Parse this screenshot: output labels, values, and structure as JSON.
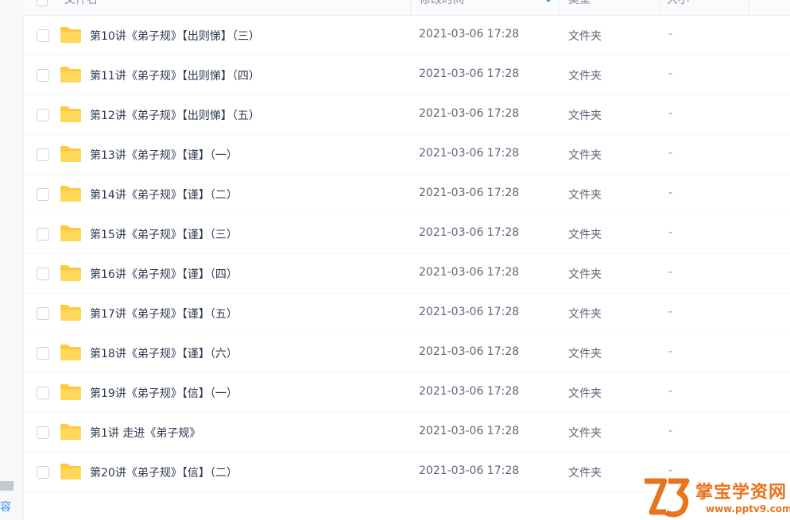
{
  "header": {
    "col_name": "文件名",
    "col_modified": "修改时间",
    "col_type": "类型",
    "col_size": "大小"
  },
  "left_edge_text": "容",
  "files": [
    {
      "name": "第10讲《弟子规》【出则悌】（三）",
      "modified": "2021-03-06 17:28",
      "type": "文件夹",
      "size": "-"
    },
    {
      "name": "第11讲《弟子规》【出则悌】（四）",
      "modified": "2021-03-06 17:28",
      "type": "文件夹",
      "size": "-"
    },
    {
      "name": "第12讲《弟子规》【出则悌】（五）",
      "modified": "2021-03-06 17:28",
      "type": "文件夹",
      "size": "-"
    },
    {
      "name": "第13讲《弟子规》【谨】（一）",
      "modified": "2021-03-06 17:28",
      "type": "文件夹",
      "size": "-"
    },
    {
      "name": "第14讲《弟子规》【谨】（二）",
      "modified": "2021-03-06 17:28",
      "type": "文件夹",
      "size": "-"
    },
    {
      "name": "第15讲《弟子规》【谨】（三）",
      "modified": "2021-03-06 17:28",
      "type": "文件夹",
      "size": "-"
    },
    {
      "name": "第16讲《弟子规》【谨】（四）",
      "modified": "2021-03-06 17:28",
      "type": "文件夹",
      "size": "-"
    },
    {
      "name": "第17讲《弟子规》【谨】（五）",
      "modified": "2021-03-06 17:28",
      "type": "文件夹",
      "size": "-"
    },
    {
      "name": "第18讲《弟子规》【谨】（六）",
      "modified": "2021-03-06 17:28",
      "type": "文件夹",
      "size": "-"
    },
    {
      "name": "第19讲《弟子规》【信】（一）",
      "modified": "2021-03-06 17:28",
      "type": "文件夹",
      "size": "-"
    },
    {
      "name": "第1讲 走进《弟子规》",
      "modified": "2021-03-06 17:28",
      "type": "文件夹",
      "size": "-"
    },
    {
      "name": "第20讲《弟子规》【信】（二）",
      "modified": "2021-03-06 17:28",
      "type": "文件夹",
      "size": "-"
    }
  ],
  "watermark": {
    "title": "掌宝学资网",
    "url": "www.pptv9.com"
  },
  "icons": {
    "folder": "folder-icon",
    "sort": "sort-desc-icon",
    "checkbox": "checkbox"
  },
  "colors": {
    "folder": "#ffc93c",
    "accent": "#2f8fe6",
    "watermark": "#e8741e"
  }
}
